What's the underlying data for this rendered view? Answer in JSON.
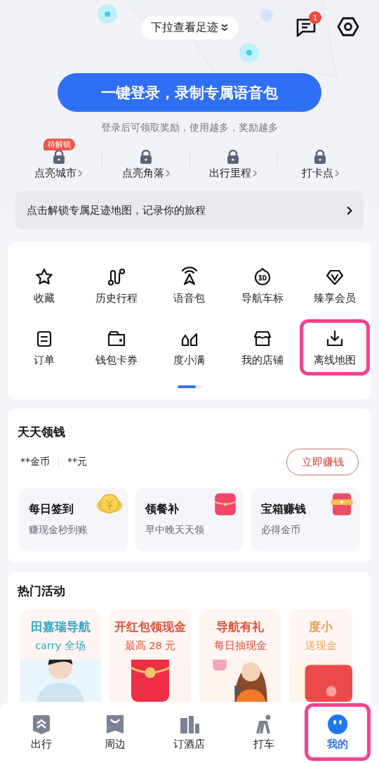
{
  "header": {
    "pull_hint": "下拉查看足迹",
    "message_badge": "1"
  },
  "login": {
    "button": "一键登录，录制专属语音包",
    "subtitle": "登录后可领取奖励，使用越多，奖励越多"
  },
  "stats": [
    {
      "label": "点亮城市",
      "badge": "待解锁"
    },
    {
      "label": "点亮角落"
    },
    {
      "label": "出行里程"
    },
    {
      "label": "打卡点"
    }
  ],
  "unlock_banner": "点击解锁专属足迹地图，记录你的旅程",
  "tools": {
    "level": 0.75,
    "items": [
      {
        "label": "收藏",
        "highlighted": false
      },
      {
        "label": "历史行程",
        "highlighted": false
      },
      {
        "label": "语音包",
        "highlighted": false
      },
      {
        "label": "导航车标",
        "highlighted": false
      },
      {
        "label": "臻享会员",
        "highlighted": false
      },
      {
        "label": "订单",
        "highlighted": false
      },
      {
        "label": "钱包卡券",
        "highlighted": false
      },
      {
        "label": "度小满",
        "highlighted": false
      },
      {
        "label": "我的店铺",
        "highlighted": false
      },
      {
        "label": "离线地图",
        "highlighted": true
      }
    ]
  },
  "earn": {
    "title": "天天领钱",
    "coins": "**金币",
    "cash": "**元",
    "button": "立即赚钱",
    "tasks": [
      {
        "title": "每日签到",
        "subtitle": "赚现金秒到账",
        "kind": "coin"
      },
      {
        "title": "领餐补",
        "subtitle": "早中晚天天领",
        "kind": "envelope"
      },
      {
        "title": "宝箱赚钱",
        "subtitle": "必得金币",
        "kind": "chest"
      }
    ]
  },
  "activities": {
    "title": "热门活动",
    "items": [
      {
        "title": "田嘉瑞导航",
        "subtitle": "carry 全场",
        "color": "#2aa7c9",
        "kind": "person"
      },
      {
        "title": "开红包领现金",
        "subtitle": "最高 28 元",
        "color": "#e2503a",
        "kind": "envelope"
      },
      {
        "title": "导航有礼",
        "subtitle": "每日抽现金",
        "color": "#e2503a",
        "kind": "woman"
      },
      {
        "title": "度小",
        "subtitle": "送现金",
        "color": "#e9a050",
        "kind": "coupon"
      }
    ]
  },
  "tabbar": [
    {
      "label": "出行",
      "selected": false,
      "highlighted": false
    },
    {
      "label": "周边",
      "selected": false,
      "highlighted": false
    },
    {
      "label": "订酒店",
      "selected": false,
      "highlighted": false
    },
    {
      "label": "打车",
      "selected": false,
      "highlighted": false
    },
    {
      "label": "我的",
      "selected": true,
      "highlighted": true
    }
  ]
}
